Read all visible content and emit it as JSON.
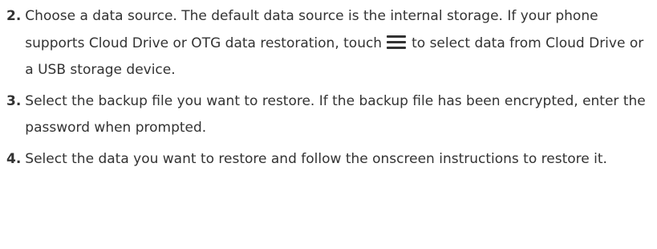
{
  "steps": [
    {
      "number": "2.",
      "text_before_icon": "Choose a data source. The default data source is the internal storage. If your phone supports Cloud Drive or OTG data restoration, touch",
      "icon": "menu-icon",
      "text_after_icon": "to select data from Cloud Drive or a USB storage device."
    },
    {
      "number": "3.",
      "text": "Select the backup file you want to restore. If the backup file has been encrypted, enter the password when prompted."
    },
    {
      "number": "4.",
      "text": "Select the data you want to restore and follow the onscreen instructions to restore it."
    }
  ],
  "colors": {
    "text": "#333333",
    "background": "#ffffff"
  }
}
